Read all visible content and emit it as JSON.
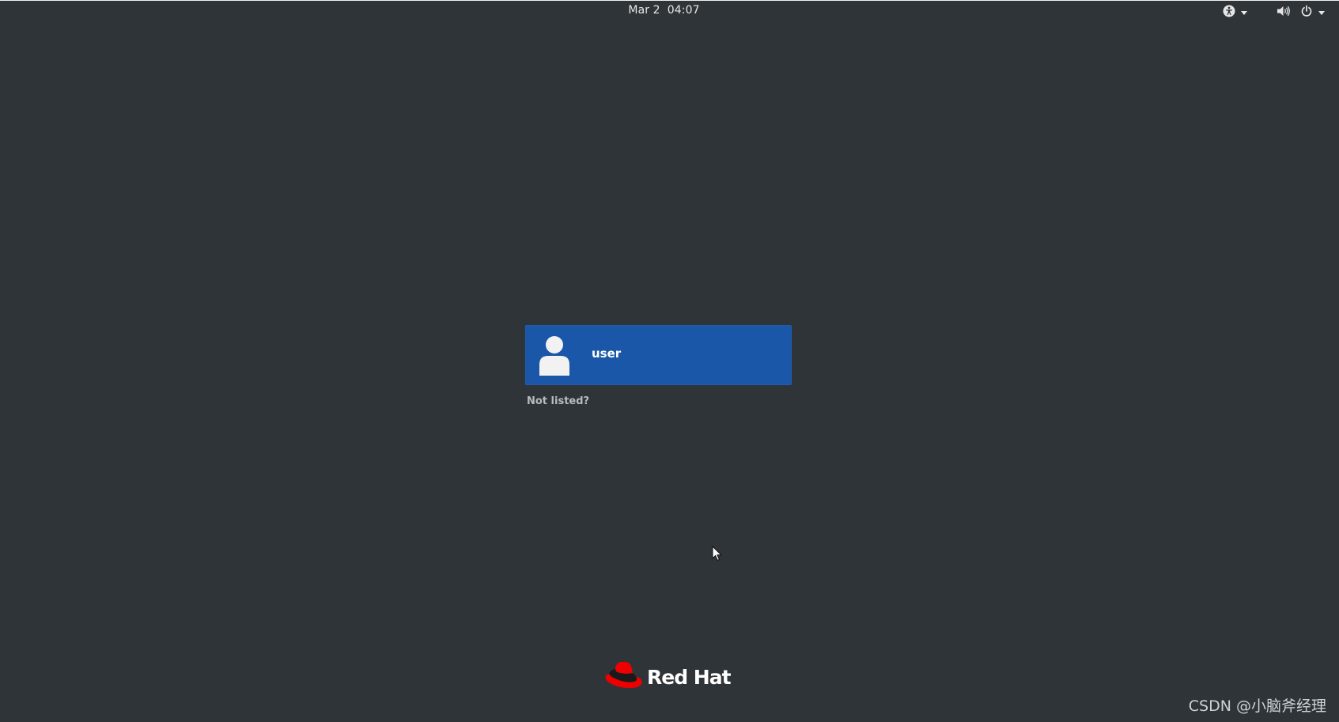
{
  "topbar": {
    "clock": "Mar 2  04:07",
    "accessibility_icon": "accessibility-icon",
    "volume_icon": "volume-icon",
    "power_icon": "power-icon"
  },
  "login": {
    "user_name": "user",
    "avatar_icon": "user-avatar-icon",
    "not_listed": "Not listed?"
  },
  "branding": {
    "logo_icon": "redhat-fedora-icon",
    "name": "Red Hat"
  },
  "watermark": "CSDN @小脑斧经理",
  "colors": {
    "background": "#2f3438",
    "user_card": "#1b57a8",
    "logo_red": "#ee0000"
  }
}
